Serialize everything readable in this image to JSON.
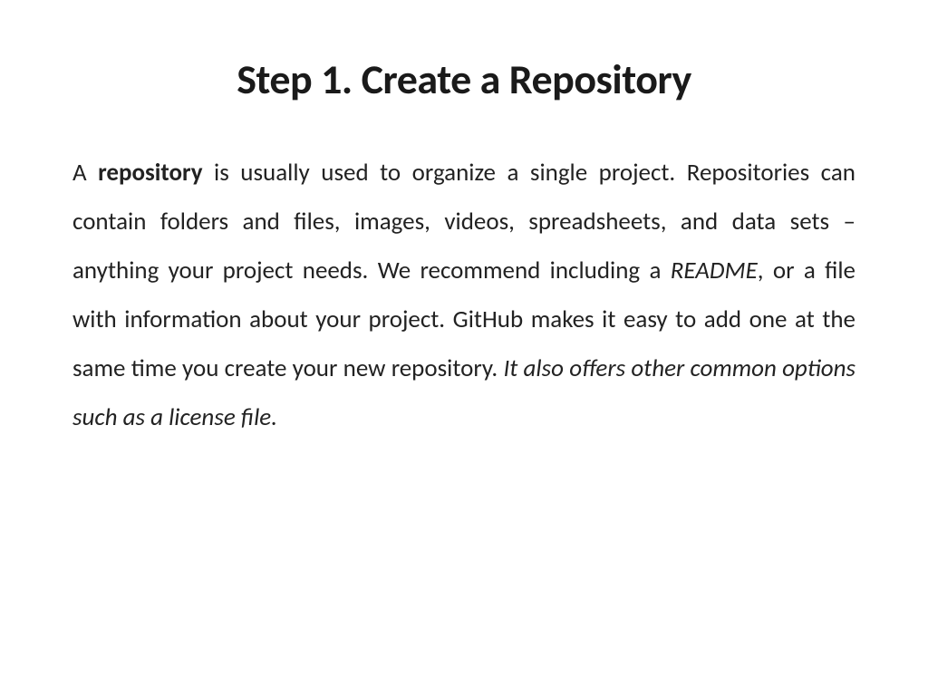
{
  "title": "Step 1. Create a Repository",
  "para": {
    "s1_prefix": "A ",
    "s1_bold": "repository",
    "s1_suffix": " is usually used to organize a single project. Repositories can contain folders and files, images, videos, spreadsheets, and data sets – anything your project needs. We recommend including a ",
    "s1_italic1": "README",
    "s1_mid": ", or a file with information about your project. GitHub makes it easy to add one at the same time you create your new repository. ",
    "s1_italic2": "It also offers other common options such as a license file."
  }
}
